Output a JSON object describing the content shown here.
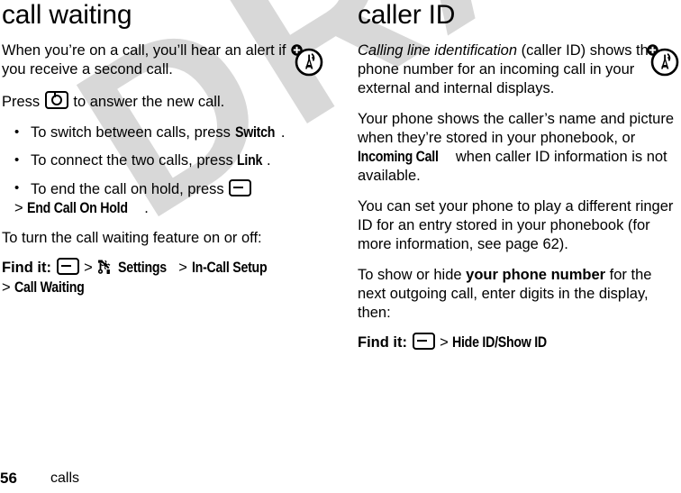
{
  "watermark": {
    "text": "DRAFT"
  },
  "footer": {
    "page_number": "56",
    "chapter": "calls"
  },
  "margin_icons": {
    "left": "network-indicator-icon",
    "right": "network-indicator-icon"
  },
  "left_column": {
    "title": "call waiting",
    "intro": "When you’re on a call, you’ll hear an alert if you receive a second call.",
    "press_prefix": "Press",
    "press_key": "send-key-icon",
    "press_suffix": "to answer the new call.",
    "bullets": [
      {
        "prefix": "To switch between calls, press ",
        "ui": "Switch",
        "suffix": "."
      },
      {
        "prefix": "To connect the two calls, press ",
        "ui": "Link",
        "suffix": "."
      },
      {
        "prefix": "To end the call on hold, press ",
        "key": "menu-key-icon",
        "cont_gt": ">",
        "cont_ui": "End Call On Hold",
        "cont_suffix": "."
      }
    ],
    "toggle_text": "To turn the call waiting feature on or off:",
    "find_it": {
      "label": "Find it:",
      "key": "menu-key-icon",
      "gt1": ">",
      "settings_icon": "settings-tools-icon",
      "step1": "Settings",
      "gt2": ">",
      "step2": "In-Call Setup",
      "gt3": ">",
      "step3": "Call Waiting"
    }
  },
  "right_column": {
    "title": "caller ID",
    "para1_em": "Calling line identification",
    "para1_rest": " (caller ID) shows the phone number for an incoming call in your external and internal displays.",
    "para2_a": "Your phone shows the caller’s name and picture when they’re stored in your phonebook, or ",
    "para2_ui": "Incoming Call",
    "para2_b": " when caller ID information is not available.",
    "para3": "You can set your phone to play a different ringer ID for an entry stored in your phonebook (for more information, see page 62).",
    "para4_a": "To show or hide ",
    "para4_bold": "your phone number",
    "para4_b": " for the next outgoing call, enter digits in the display, then:",
    "find_it": {
      "label": "Find it:",
      "key": "menu-key-icon",
      "gt1": ">",
      "step1": "Hide ID/Show ID"
    }
  },
  "colors": {
    "text": "#000000",
    "watermark": "#d8d8d8",
    "background": "#ffffff"
  }
}
